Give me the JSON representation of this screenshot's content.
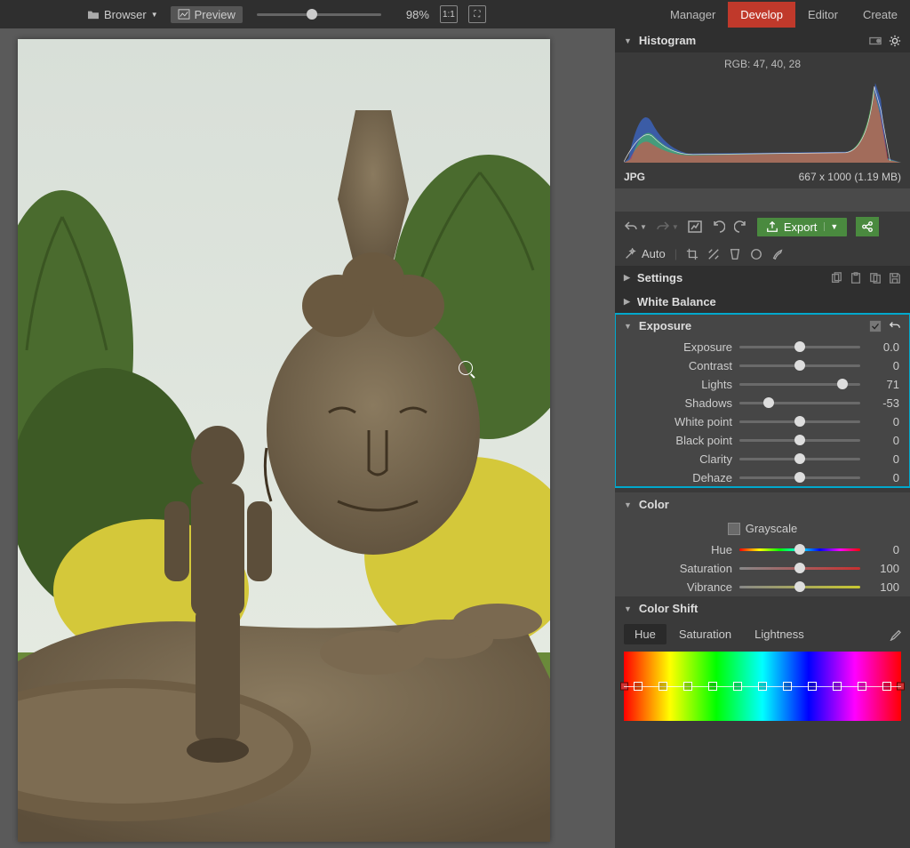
{
  "top": {
    "browser": "Browser",
    "preview": "Preview",
    "zoom": "98%",
    "actual": "1:1"
  },
  "tabs": {
    "manager": "Manager",
    "develop": "Develop",
    "editor": "Editor",
    "create": "Create"
  },
  "hist": {
    "title": "Histogram",
    "rgb": "RGB: 47, 40, 28"
  },
  "file": {
    "fmt": "JPG",
    "size": "667 x 1000 (1.19 MB)"
  },
  "export": "Export",
  "auto": "Auto",
  "sec": {
    "settings": "Settings",
    "wb": "White Balance",
    "exp": "Exposure",
    "color": "Color",
    "cshift": "Color Shift"
  },
  "exp": {
    "exposure": {
      "l": "Exposure",
      "v": "0.0",
      "p": 50
    },
    "contrast": {
      "l": "Contrast",
      "v": "0",
      "p": 50
    },
    "lights": {
      "l": "Lights",
      "v": "71",
      "p": 85
    },
    "shadows": {
      "l": "Shadows",
      "v": "-53",
      "p": 24
    },
    "white": {
      "l": "White point",
      "v": "0",
      "p": 50
    },
    "black": {
      "l": "Black point",
      "v": "0",
      "p": 50
    },
    "clarity": {
      "l": "Clarity",
      "v": "0",
      "p": 50
    },
    "dehaze": {
      "l": "Dehaze",
      "v": "0",
      "p": 50
    }
  },
  "color": {
    "gray": "Grayscale",
    "hue": {
      "l": "Hue",
      "v": "0",
      "p": 50
    },
    "sat": {
      "l": "Saturation",
      "v": "100",
      "p": 50
    },
    "vib": {
      "l": "Vibrance",
      "v": "100",
      "p": 50
    }
  },
  "cshift": {
    "hue": "Hue",
    "sat": "Saturation",
    "light": "Lightness"
  }
}
